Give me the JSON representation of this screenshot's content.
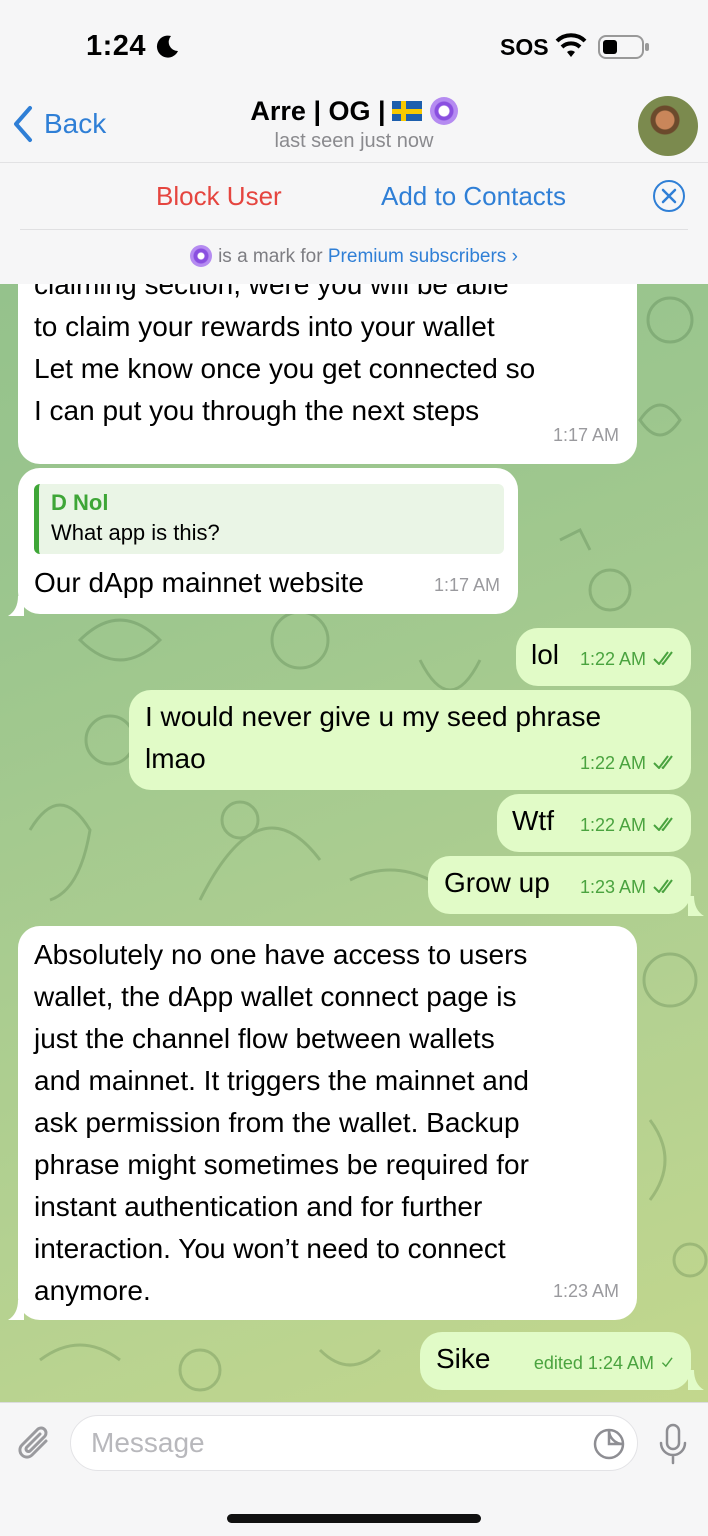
{
  "status_bar": {
    "time": "1:24",
    "carrier": "SOS"
  },
  "header": {
    "back_label": "Back",
    "title": "Arre | OG |",
    "subtitle": "last seen just now"
  },
  "actions": {
    "block_label": "Block User",
    "add_label": "Add to Contacts",
    "premium_note_prefix": "is a mark for",
    "premium_note_link": "Premium subscribers",
    "premium_note_chevron": "›"
  },
  "messages": [
    {
      "direction": "in",
      "lines": [
        "claiming section, were you will be able",
        "to claim your rewards into your wallet",
        "Let me know once you get connected so",
        "I can put you through the next steps"
      ],
      "time": "1:17 AM"
    },
    {
      "direction": "in",
      "reply_name": "D Nol",
      "reply_text": "What app is this?",
      "text": "Our dApp mainnet website",
      "time": "1:17 AM"
    },
    {
      "direction": "out",
      "text": "lol",
      "time": "1:22 AM"
    },
    {
      "direction": "out",
      "lines": [
        "I would never give u my seed phrase",
        "lmao"
      ],
      "time": "1:22 AM"
    },
    {
      "direction": "out",
      "text": "Wtf",
      "time": "1:22 AM"
    },
    {
      "direction": "out",
      "text": "Grow up",
      "time": "1:23 AM"
    },
    {
      "direction": "in",
      "lines": [
        "Absolutely no one have access to users",
        "wallet, the dApp wallet connect page is",
        "just the channel flow between wallets",
        "and mainnet. It triggers the mainnet and",
        "ask permission from the wallet. Backup",
        "phrase might sometimes be required for",
        "instant authentication and for further",
        "interaction. You won’t need to connect",
        "anymore."
      ],
      "time": "1:23 AM"
    },
    {
      "direction": "out",
      "text": "Sike",
      "time": "edited 1:24 AM"
    }
  ],
  "input": {
    "placeholder": "Message"
  },
  "icons": {
    "back": "chevron-left-icon",
    "close": "close-circle-icon",
    "attach": "paperclip-icon",
    "sticker": "sticker-icon",
    "mic": "microphone-icon",
    "read": "double-check-icon",
    "sent": "single-check-icon"
  },
  "colors": {
    "accent": "#2f7fd6",
    "danger": "#e5453f",
    "outgoing_bubble": "#e1fbc7",
    "outgoing_time": "#4aa33f",
    "wallpaper": "#9cc68e"
  }
}
